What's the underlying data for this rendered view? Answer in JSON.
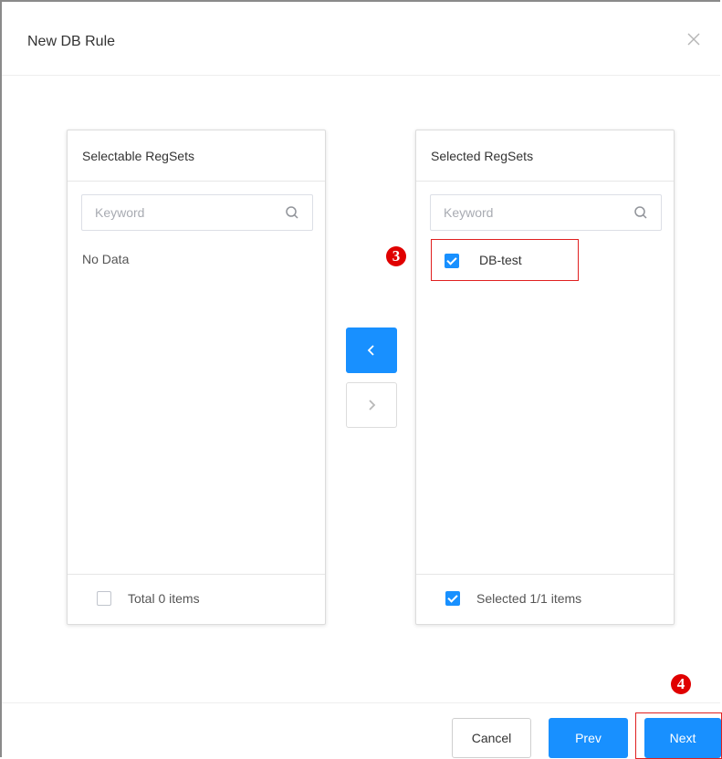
{
  "dialog": {
    "title": "New DB Rule"
  },
  "source_panel": {
    "header": "Selectable RegSets",
    "search_placeholder": "Keyword",
    "empty_text": "No Data",
    "footer_text": "Total 0 items",
    "footer_checked": false
  },
  "target_panel": {
    "header": "Selected RegSets",
    "search_placeholder": "Keyword",
    "items": [
      {
        "label": "DB-test",
        "checked": true
      }
    ],
    "footer_text": "Selected 1/1 items",
    "footer_checked": true
  },
  "annotations": {
    "step_item": "3",
    "step_next": "4"
  },
  "buttons": {
    "cancel": "Cancel",
    "prev": "Prev",
    "next": "Next"
  },
  "colors": {
    "primary": "#1890ff",
    "highlight": "#e02020"
  }
}
